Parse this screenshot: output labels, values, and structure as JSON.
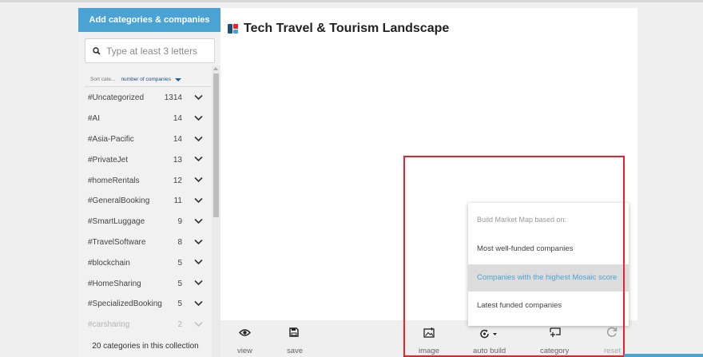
{
  "sidebar": {
    "add_button": "Add categories & companies",
    "search_placeholder": "Type at least 3 letters",
    "sort_label": "Sort cate...",
    "sort_value": "number of companies",
    "categories": [
      {
        "name": "#Uncategorized",
        "count": "1314"
      },
      {
        "name": "#AI",
        "count": "14"
      },
      {
        "name": "#Asia-Pacific",
        "count": "14"
      },
      {
        "name": "#PrivateJet",
        "count": "13"
      },
      {
        "name": "#homeRentals",
        "count": "12"
      },
      {
        "name": "#GeneralBooking",
        "count": "11"
      },
      {
        "name": "#SmartLuggage",
        "count": "9"
      },
      {
        "name": "#TravelSoftware",
        "count": "8"
      },
      {
        "name": "#blockchain",
        "count": "5"
      },
      {
        "name": "#HomeSharing",
        "count": "5"
      },
      {
        "name": "#SpecializedBooking",
        "count": "5"
      },
      {
        "name": "#carsharing",
        "count": "2"
      }
    ],
    "footer": "20 categories in this collection"
  },
  "main": {
    "title": "Tech Travel & Tourism Landscape"
  },
  "toolbar": {
    "view": "view",
    "save": "save",
    "image": "image",
    "auto_build": "auto build",
    "category": "category",
    "reset": "reset"
  },
  "dropdown": {
    "header": "Build Market Map based on:",
    "items": [
      "Most well-funded companies",
      "Companies with the highest Mosaic score",
      "Latest funded companies"
    ]
  },
  "colors": {
    "accent": "#4ba3d3",
    "highlight": "#e8212a"
  }
}
